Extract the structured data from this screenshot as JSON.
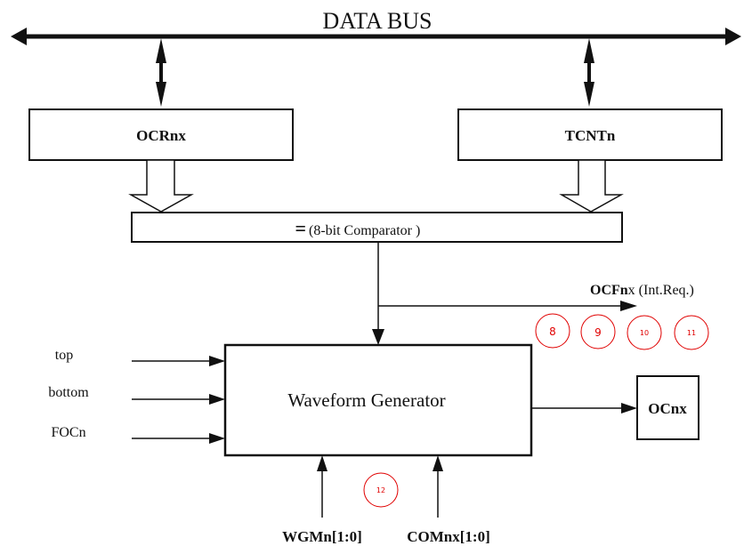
{
  "diagram": {
    "title": "DATA BUS",
    "blocks": {
      "ocr": "OCRnx",
      "tcnt": "TCNTn",
      "comparator_symbol": "=",
      "comparator": "(8-bit Comparator )",
      "waveform": "Waveform Generator",
      "output": "OCnx"
    },
    "signals": {
      "ocf_bold": "OCFn",
      "ocf_rest": "x (Int.Req.)",
      "top": "top",
      "bottom": "bottom",
      "foc": "FOCn",
      "wgm": "WGMn[1:0]",
      "com": "COMnx[1:0]"
    },
    "markers": [
      "8",
      "9",
      "10",
      "11",
      "12"
    ],
    "colors": {
      "line": "#111111",
      "marker": "#e00000"
    }
  }
}
